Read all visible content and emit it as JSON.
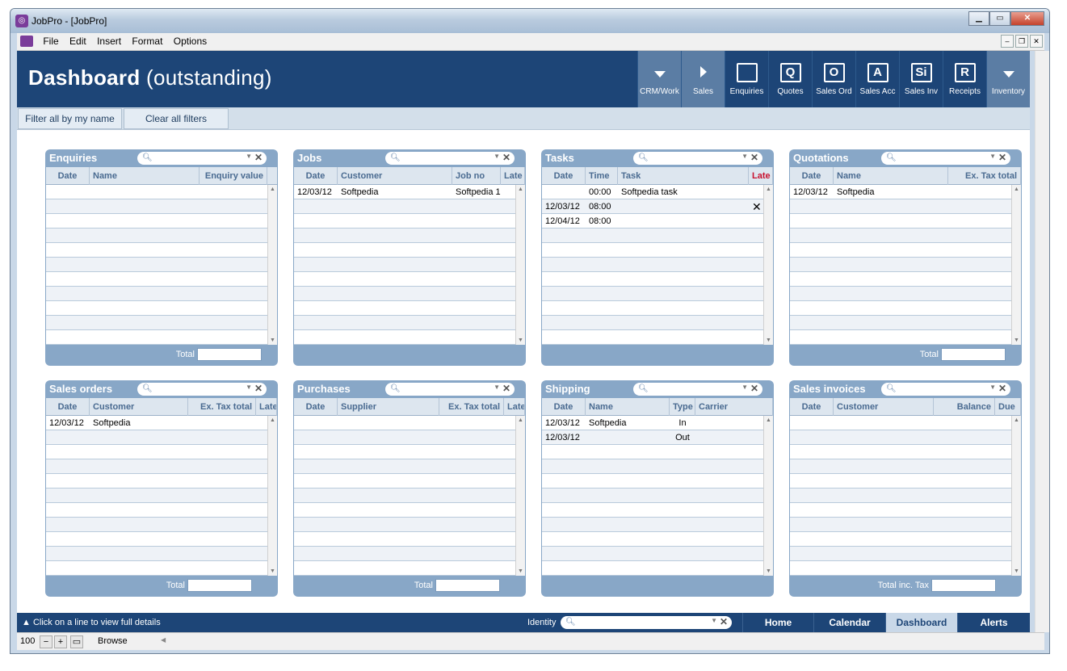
{
  "window": {
    "title": "JobPro - [JobPro]",
    "app_icon": "jobpro-icon"
  },
  "menu": [
    "File",
    "Edit",
    "Insert",
    "Format",
    "Options"
  ],
  "header": {
    "title": "Dashboard",
    "subtitle": "(outstanding)"
  },
  "nav": [
    {
      "label": "CRM/Work",
      "icon": "chevron-down-icon",
      "glyph": ""
    },
    {
      "label": "Sales",
      "icon": "chevron-right-icon",
      "glyph": ""
    },
    {
      "label": "Enquiries",
      "icon": "folder-icon",
      "glyph": ""
    },
    {
      "label": "Quotes",
      "icon": "quote-icon",
      "glyph": "Q"
    },
    {
      "label": "Sales Ord",
      "icon": "order-icon",
      "glyph": "O"
    },
    {
      "label": "Sales Acc",
      "icon": "account-icon",
      "glyph": "A"
    },
    {
      "label": "Sales Inv",
      "icon": "invoice-icon",
      "glyph": "Si"
    },
    {
      "label": "Receipts",
      "icon": "receipt-icon",
      "glyph": "R"
    },
    {
      "label": "Inventory",
      "icon": "chevron-down-icon",
      "glyph": ""
    }
  ],
  "filters": {
    "mine": "Filter all by my name",
    "clear": "Clear all filters"
  },
  "panels": [
    {
      "title": "Enquiries",
      "columns": [
        "Date",
        "Name",
        "Enquiry value"
      ],
      "rows": [],
      "total": "Total"
    },
    {
      "title": "Jobs",
      "columns": [
        "Date",
        "Customer",
        "Job no",
        "Late"
      ],
      "rows": [
        [
          "12/03/12",
          "Softpedia",
          "Softpedia 1",
          ""
        ]
      ],
      "total": ""
    },
    {
      "title": "Tasks",
      "columns": [
        "Date",
        "Time",
        "Task",
        "Late"
      ],
      "rows": [
        [
          "",
          "00:00",
          "Softpedia task",
          ""
        ],
        [
          "12/03/12",
          "08:00",
          "",
          "X"
        ],
        [
          "12/04/12",
          "08:00",
          "",
          ""
        ]
      ],
      "total": ""
    },
    {
      "title": "Quotations",
      "columns": [
        "Date",
        "Name",
        "Ex. Tax total"
      ],
      "rows": [
        [
          "12/03/12",
          "Softpedia",
          ""
        ]
      ],
      "total": "Total"
    },
    {
      "title": "Sales orders",
      "columns": [
        "Date",
        "Customer",
        "Ex. Tax total",
        "Late"
      ],
      "rows": [
        [
          "12/03/12",
          "Softpedia",
          "",
          ""
        ]
      ],
      "total": "Total"
    },
    {
      "title": "Purchases",
      "columns": [
        "Date",
        "Supplier",
        "Ex. Tax total",
        "Late"
      ],
      "rows": [],
      "total": "Total"
    },
    {
      "title": "Shipping",
      "columns": [
        "Date",
        "Name",
        "Type",
        "Carrier"
      ],
      "rows": [
        [
          "12/03/12",
          "Softpedia",
          "In",
          ""
        ],
        [
          "12/03/12",
          "",
          "Out",
          ""
        ]
      ],
      "total": ""
    },
    {
      "title": "Sales invoices",
      "columns": [
        "Date",
        "Customer",
        "Balance",
        "Due"
      ],
      "rows": [],
      "total": "Total inc. Tax"
    }
  ],
  "status": {
    "hint": "Click on a line to view  full details",
    "identity_label": "Identity"
  },
  "tabs": [
    "Home",
    "Calendar",
    "Dashboard",
    "Alerts"
  ],
  "active_tab": "Dashboard",
  "bottom": {
    "zoom": "100",
    "mode": "Browse"
  }
}
